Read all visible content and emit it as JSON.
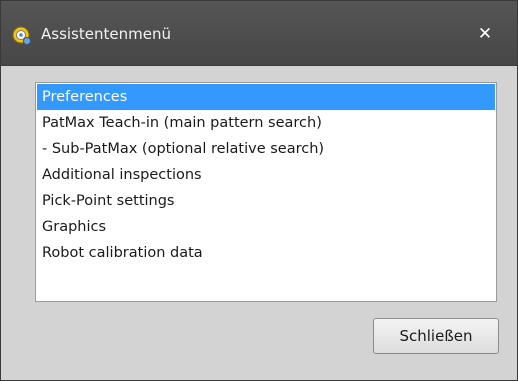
{
  "window": {
    "title": "Assistentenmenü",
    "app_icon": "assistant-icon",
    "close_glyph": "✕",
    "close_icon": "close-icon"
  },
  "list": {
    "selected_index": 0,
    "items": [
      {
        "label": "Preferences"
      },
      {
        "label": "PatMax Teach-in (main pattern search)"
      },
      {
        "label": "- Sub-PatMax (optional relative search)"
      },
      {
        "label": "Additional inspections"
      },
      {
        "label": "Pick-Point settings"
      },
      {
        "label": "Graphics"
      },
      {
        "label": "Robot calibration data"
      }
    ]
  },
  "footer": {
    "close_label": "Schließen"
  },
  "colors": {
    "titlebar": "#4d4d4d",
    "dialog_bg": "#d3d3d3",
    "selection": "#3399ff"
  }
}
